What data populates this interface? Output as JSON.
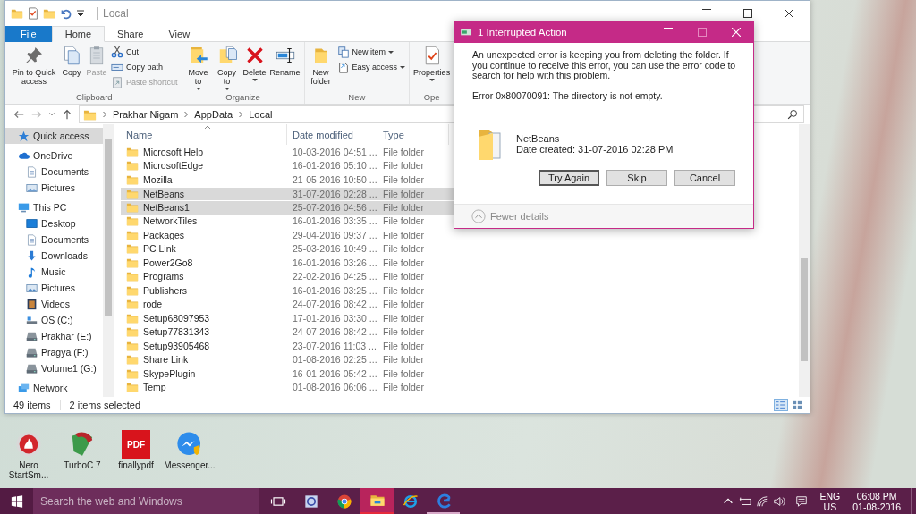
{
  "explorer": {
    "title": "Local",
    "tabs": [
      {
        "label": "File",
        "kind": "file",
        "selected": false
      },
      {
        "label": "Home",
        "kind": "tab",
        "selected": true
      },
      {
        "label": "Share",
        "kind": "tab",
        "selected": false
      },
      {
        "label": "View",
        "kind": "tab",
        "selected": false
      }
    ],
    "ribbon": {
      "groups": [
        {
          "label": "Clipboard",
          "items": [
            {
              "label": "Pin to Quick access",
              "kind": "large",
              "dropdown": false,
              "disabled": false
            },
            {
              "label": "Copy",
              "kind": "large",
              "dropdown": false,
              "disabled": false
            },
            {
              "label": "Paste",
              "kind": "large",
              "dropdown": false,
              "disabled": true
            },
            {
              "label": "Cut",
              "kind": "small",
              "dropdown": false,
              "disabled": false
            },
            {
              "label": "Copy path",
              "kind": "small",
              "dropdown": false,
              "disabled": false
            },
            {
              "label": "Paste shortcut",
              "kind": "small",
              "dropdown": false,
              "disabled": true
            }
          ]
        },
        {
          "label": "Organize",
          "items": [
            {
              "label": "Move to",
              "kind": "large",
              "dropdown": true,
              "disabled": false
            },
            {
              "label": "Copy to",
              "kind": "large",
              "dropdown": true,
              "disabled": false
            },
            {
              "label": "Delete",
              "kind": "large",
              "dropdown": true,
              "disabled": false
            },
            {
              "label": "Rename",
              "kind": "large",
              "dropdown": false,
              "disabled": false
            }
          ]
        },
        {
          "label": "New",
          "items": [
            {
              "label": "New folder",
              "kind": "large",
              "dropdown": false,
              "disabled": false
            },
            {
              "label": "New item",
              "kind": "small",
              "dropdown": true,
              "disabled": false
            },
            {
              "label": "Easy access",
              "kind": "small",
              "dropdown": true,
              "disabled": false
            }
          ]
        },
        {
          "label": "Ope",
          "items": [
            {
              "label": "Properties",
              "kind": "large",
              "dropdown": true,
              "disabled": false
            }
          ]
        }
      ]
    },
    "address": {
      "path": [
        "Prakhar Nigam",
        "AppData",
        "Local"
      ]
    },
    "sidebar": {
      "items": [
        {
          "label": "Quick access",
          "selected": true
        },
        {
          "label": "OneDrive",
          "selected": false,
          "children": [
            {
              "label": "Documents",
              "selected": false
            },
            {
              "label": "Pictures",
              "selected": false
            }
          ]
        },
        {
          "label": "This PC",
          "selected": false,
          "children": [
            {
              "label": "Desktop",
              "selected": false
            },
            {
              "label": "Documents",
              "selected": false
            },
            {
              "label": "Downloads",
              "selected": false
            },
            {
              "label": "Music",
              "selected": false
            },
            {
              "label": "Pictures",
              "selected": false
            },
            {
              "label": "Videos",
              "selected": false
            },
            {
              "label": "OS (C:)",
              "selected": false
            },
            {
              "label": "Prakhar (E:)",
              "selected": false
            },
            {
              "label": "Pragya (F:)",
              "selected": false
            },
            {
              "label": "Volume1 (G:)",
              "selected": false
            }
          ]
        },
        {
          "label": "Network",
          "selected": false
        }
      ]
    },
    "table": {
      "columns": [
        {
          "label": "Name",
          "sorted": true
        },
        {
          "label": "Date modified",
          "sorted": false
        },
        {
          "label": "Type",
          "sorted": false
        }
      ],
      "rows": [
        {
          "name": "Microsoft Help",
          "date": "10-03-2016 04:51 ...",
          "type": "File folder",
          "selected": false
        },
        {
          "name": "MicrosoftEdge",
          "date": "16-01-2016 05:10 ...",
          "type": "File folder",
          "selected": false
        },
        {
          "name": "Mozilla",
          "date": "21-05-2016 10:50 ...",
          "type": "File folder",
          "selected": false
        },
        {
          "name": "NetBeans",
          "date": "31-07-2016 02:28 ...",
          "type": "File folder",
          "selected": true
        },
        {
          "name": "NetBeans1",
          "date": "25-07-2016 04:56 ...",
          "type": "File folder",
          "selected": true
        },
        {
          "name": "NetworkTiles",
          "date": "16-01-2016 03:35 ...",
          "type": "File folder",
          "selected": false
        },
        {
          "name": "Packages",
          "date": "29-04-2016 09:37 ...",
          "type": "File folder",
          "selected": false
        },
        {
          "name": "PC Link",
          "date": "25-03-2016 10:49 ...",
          "type": "File folder",
          "selected": false
        },
        {
          "name": "Power2Go8",
          "date": "16-01-2016 03:26 ...",
          "type": "File folder",
          "selected": false
        },
        {
          "name": "Programs",
          "date": "22-02-2016 04:25 ...",
          "type": "File folder",
          "selected": false
        },
        {
          "name": "Publishers",
          "date": "16-01-2016 03:25 ...",
          "type": "File folder",
          "selected": false
        },
        {
          "name": "rode",
          "date": "24-07-2016 08:42 ...",
          "type": "File folder",
          "selected": false
        },
        {
          "name": "Setup68097953",
          "date": "17-01-2016 03:30 ...",
          "type": "File folder",
          "selected": false
        },
        {
          "name": "Setup77831343",
          "date": "24-07-2016 08:42 ...",
          "type": "File folder",
          "selected": false
        },
        {
          "name": "Setup93905468",
          "date": "23-07-2016 11:03 ...",
          "type": "File folder",
          "selected": false
        },
        {
          "name": "Share Link",
          "date": "01-08-2016 02:25 ...",
          "type": "File folder",
          "selected": false
        },
        {
          "name": "SkypePlugin",
          "date": "16-01-2016 05:42 ...",
          "type": "File folder",
          "selected": false
        },
        {
          "name": "Temp",
          "date": "01-08-2016 06:06 ...",
          "type": "File folder",
          "selected": false
        }
      ]
    },
    "status_bar": {
      "count": "49 items",
      "selection": "2 items selected",
      "view_buttons": [
        {
          "kind": "details",
          "selected": true
        },
        {
          "kind": "large_icons",
          "selected": false
        }
      ]
    }
  },
  "dialog": {
    "title": "1 Interrupted Action",
    "message": "An unexpected error is keeping you from deleting the folder. If you continue to receive this error, you can use the error code to search for help with this problem.",
    "error": "Error 0x80070091: The directory is not empty.",
    "item_name": "NetBeans",
    "item_date": "Date created: 31-07-2016 02:28 PM",
    "buttons": [
      {
        "label": "Try Again",
        "selected": true
      },
      {
        "label": "Skip",
        "selected": false
      },
      {
        "label": "Cancel",
        "selected": false
      }
    ],
    "details_toggle": "Fewer details"
  },
  "desktop_icons": [
    {
      "label": "Nero StartSm..."
    },
    {
      "label": "TurboC 7"
    },
    {
      "label": "finallypdf",
      "icon_text": "PDF"
    },
    {
      "label": "Messenger..."
    }
  ],
  "taskbar": {
    "search_placeholder": "Search the web and Windows",
    "apps": [
      {
        "selected": false,
        "running": false
      },
      {
        "selected": false,
        "running": false
      },
      {
        "selected": false,
        "running": false
      },
      {
        "selected": true,
        "running": true
      },
      {
        "selected": false,
        "running": false
      },
      {
        "selected": false,
        "running": true
      }
    ],
    "tray": {
      "language": "ENG",
      "region": "US",
      "time": "06:08 PM",
      "date": "01-08-2016"
    }
  }
}
